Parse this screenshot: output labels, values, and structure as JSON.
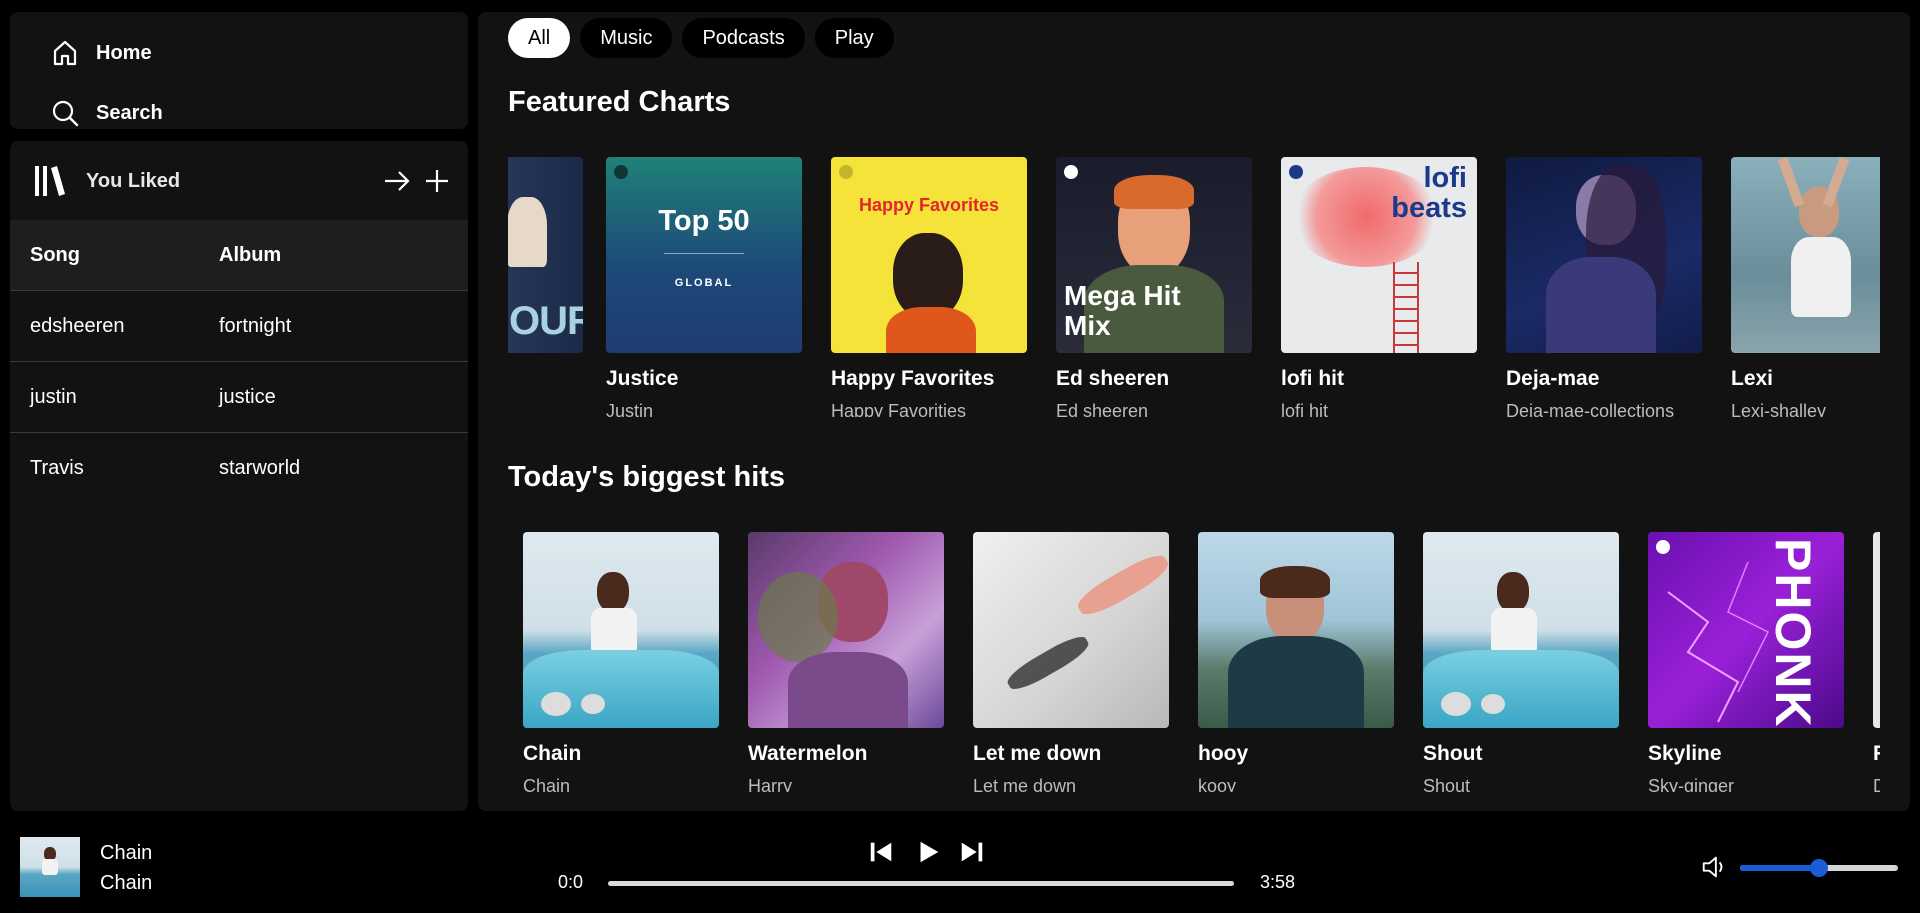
{
  "nav": {
    "home": "Home",
    "search": "Search"
  },
  "library": {
    "title": "You Liked",
    "columns": [
      "Song",
      "Album"
    ],
    "rows": [
      {
        "song": "edsheeren",
        "album": "fortnight"
      },
      {
        "song": "justin",
        "album": "justice"
      },
      {
        "song": "Travis",
        "album": "starworld"
      }
    ]
  },
  "filters": [
    "All",
    "Music",
    "Podcasts",
    "Play"
  ],
  "sections": {
    "featured": {
      "title": "Featured Charts",
      "cards": [
        {
          "title": "",
          "subtitle": "",
          "cover_text": "OUR"
        },
        {
          "title": "Justice",
          "subtitle": "Justin",
          "cover_text": "Top 50",
          "cover_sub": "GLOBAL"
        },
        {
          "title": "Happy Favorites",
          "subtitle": "Happy Favorities",
          "cover_text": "Happy Favorites"
        },
        {
          "title": "Ed sheeren",
          "subtitle": "Ed sheeren",
          "cover_text": "Mega Hit Mix"
        },
        {
          "title": "lofi hit",
          "subtitle": "lofi hit",
          "cover_text": "lofi beats"
        },
        {
          "title": "Deja-mae",
          "subtitle": "Deja-mae-collections"
        },
        {
          "title": "Lexi",
          "subtitle": "Lexi-shalley"
        }
      ]
    },
    "hits": {
      "title": "Today's biggest hits",
      "cards": [
        {
          "title": "Chain",
          "subtitle": "Chain"
        },
        {
          "title": "Watermelon",
          "subtitle": "Harry"
        },
        {
          "title": "Let me down",
          "subtitle": "Let me down"
        },
        {
          "title": "hooy",
          "subtitle": "kooy"
        },
        {
          "title": "Shout",
          "subtitle": "Shout"
        },
        {
          "title": "Skyline",
          "subtitle": "Sky-ginger",
          "cover_text": "PHONK"
        },
        {
          "title": "F",
          "subtitle": "D"
        }
      ]
    }
  },
  "player": {
    "title": "Chain",
    "artist": "Chain",
    "current_time": "0:0",
    "duration": "3:58",
    "progress": 0,
    "volume": 0.5
  },
  "colors": {
    "accent": "#1a5cd6",
    "panel": "#121212"
  }
}
